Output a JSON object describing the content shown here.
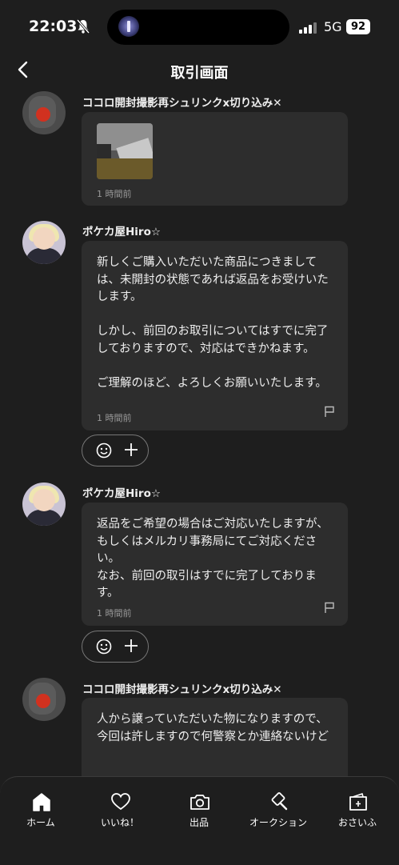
{
  "status_bar": {
    "time": "22:03",
    "network": "5G",
    "battery": "92"
  },
  "header": {
    "title": "取引画面"
  },
  "messages": [
    {
      "sender": "ココロ開封撮影再シュリンクx切り込み✕",
      "text": "",
      "timestamp": "1 時間前"
    },
    {
      "sender": "ポケカ屋Hiro☆",
      "text": "新しくご購入いただいた商品につきましては、未開封の状態であれば返品をお受けいたします。\n\nしかし、前回のお取引についてはすでに完了しておりますので、対応はできかねます。\n\nご理解のほど、よろしくお願いいたします。",
      "timestamp": "1 時間前"
    },
    {
      "sender": "ポケカ屋Hiro☆",
      "text": "返品をご希望の場合はご対応いたしますが、もしくはメルカリ事務局にてご対応ください。\nなお、前回の取引はすでに完了しております。",
      "timestamp": "1 時間前"
    },
    {
      "sender": "ココロ開封撮影再シュリンクx切り込み✕",
      "text": "人から譲っていただいた物になりますので、\n今回は許しますので何警察とか連絡ないけど",
      "timestamp": ""
    }
  ],
  "nav": [
    {
      "label": "ホーム",
      "icon": "home-icon"
    },
    {
      "label": "いいね！",
      "icon": "heart-icon"
    },
    {
      "label": "出品",
      "icon": "camera-icon"
    },
    {
      "label": "オークション",
      "icon": "gavel-icon"
    },
    {
      "label": "おさいふ",
      "icon": "wallet-icon"
    }
  ]
}
